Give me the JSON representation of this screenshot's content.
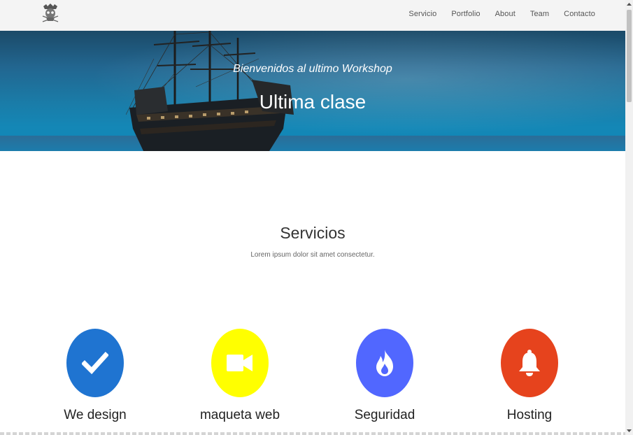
{
  "nav": {
    "items": [
      {
        "label": "Servicio"
      },
      {
        "label": "Portfolio"
      },
      {
        "label": "About"
      },
      {
        "label": "Team"
      },
      {
        "label": "Contacto"
      }
    ]
  },
  "hero": {
    "subtitle": "Bienvenidos al ultimo Workshop",
    "title": "Ultima clase"
  },
  "services_section": {
    "title": "Servicios",
    "subtitle": "Lorem ipsum dolor sit amet consectetur.",
    "items": [
      {
        "title": "We design",
        "icon": "check-icon",
        "color": "#1f74d1"
      },
      {
        "title": "maqueta web",
        "icon": "video-camera-icon",
        "color": "#ffff00"
      },
      {
        "title": "Seguridad",
        "icon": "fire-icon",
        "color": "#5167ff"
      },
      {
        "title": "Hosting",
        "icon": "bell-icon",
        "color": "#e6431d"
      }
    ]
  }
}
